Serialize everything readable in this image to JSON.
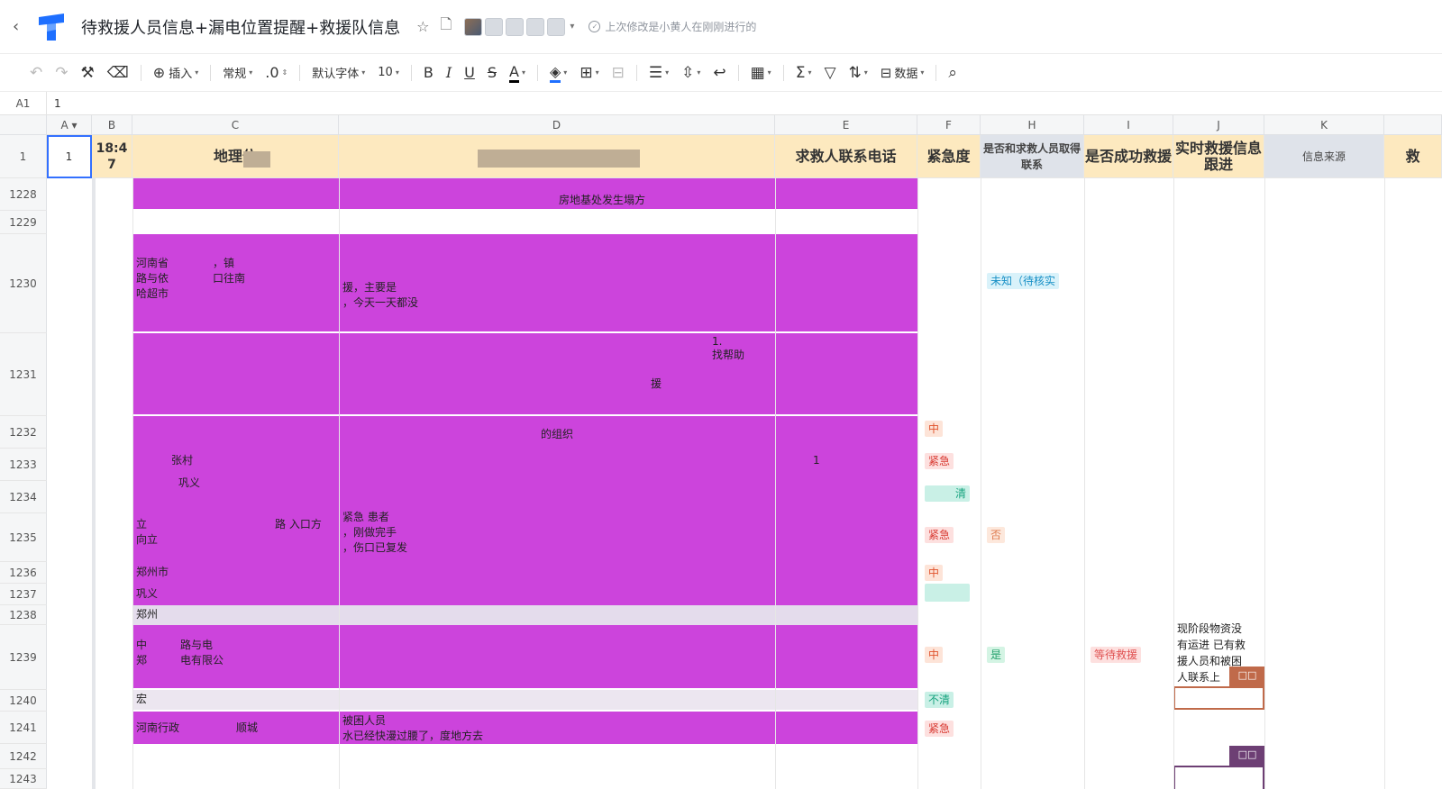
{
  "title_bar": {
    "back": "‹",
    "doc_title": "待救援人员信息+漏电位置提醒+救援队信息",
    "last_edit": "上次修改是小黄人在刚刚进行的"
  },
  "toolbar": {
    "insert": "插入",
    "format": "常规",
    "decimal": ".0",
    "font": "默认字体",
    "font_size": "10",
    "bold": "B",
    "italic": "I",
    "underline": "U",
    "strike": "S",
    "font_color": "A",
    "sum": "Σ",
    "data": "数据"
  },
  "formula_bar": {
    "cell_ref": "A1",
    "value": "1"
  },
  "columns": [
    "A",
    "B",
    "C",
    "D",
    "E",
    "F",
    "H",
    "I",
    "J",
    "K"
  ],
  "header_row": {
    "row_number": "1",
    "A": "1",
    "B": "18:4 7",
    "C": "地理位",
    "D": "",
    "E": "求救人联系电话",
    "F": "紧急度",
    "H": "是否和求救人员取得联系",
    "I": "是否成功救援",
    "J": "实时救援信息跟进",
    "K": "信息来源",
    "L": "救"
  },
  "rows": [
    {
      "num": "1228",
      "d_text": "房地基处发生塌方"
    },
    {
      "num": "1229"
    },
    {
      "num": "1230",
      "c_text": [
        "河南省",
        "路与依",
        "哈超市"
      ],
      "c_text2": "，镇",
      "c_text3": "口往南",
      "d_text": [
        "援，主要是",
        "，今天一天都没"
      ],
      "h_tag": "未知（待核实"
    },
    {
      "num": "1231",
      "d_text": [
        "1.",
        "找帮助",
        "援"
      ]
    },
    {
      "num": "1232",
      "d_text": "的组织",
      "f_tag": "中"
    },
    {
      "num": "1233",
      "c_text": "张村",
      "e_text": "1",
      "f_tag": "紧急"
    },
    {
      "num": "1234",
      "c_text": "巩义",
      "f_tag": "清"
    },
    {
      "num": "1235",
      "c_text": [
        "立",
        "向立"
      ],
      "c_text2": "路 入口方",
      "d_text": [
        "紧急  患者",
        "，刚做完手",
        "，伤口已复发"
      ],
      "f_tag": "紧急",
      "h_tag": "否"
    },
    {
      "num": "1236",
      "c_text": "郑州市",
      "f_tag": "中"
    },
    {
      "num": "1237",
      "c_text": "巩义"
    },
    {
      "num": "1238",
      "c_text": "郑州"
    },
    {
      "num": "1239",
      "c_text": [
        "中",
        "郑"
      ],
      "c_text2": "路与电",
      "c_text3": "电有限公",
      "f_tag": "中",
      "h_tag": "是",
      "i_tag": "等待救援",
      "j_text": [
        "现阶段物资没",
        "有运进 已有救",
        "援人员和被困",
        "人联系上"
      ]
    },
    {
      "num": "1240",
      "c_text": "宏",
      "f_tag": "不清"
    },
    {
      "num": "1241",
      "c_text": "河南行政",
      "c_text2": "顺城",
      "d_text": [
        "被困人员",
        "水已经快漫过腰了，度地方去"
      ],
      "f_tag": "紧急"
    },
    {
      "num": "1242"
    },
    {
      "num": "1243"
    }
  ],
  "collab_tags": [
    "□□",
    "□□"
  ],
  "colors": {
    "magenta": "#cc44dc",
    "header_bg": "#fde9bf",
    "header_grey": "#dfe3ea",
    "selection": "#3370ff"
  }
}
